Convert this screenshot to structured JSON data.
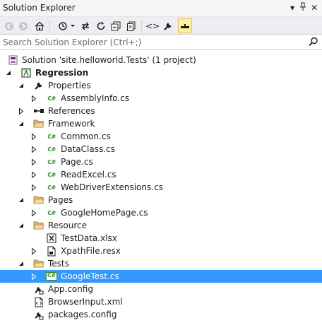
{
  "titlebar": {
    "title": "Solution Explorer",
    "dropdown_glyph": "▾",
    "pin_glyph": "ᛘ",
    "close_glyph": "✕"
  },
  "toolbar": {
    "icons": [
      "back-icon",
      "forward-icon",
      "home-icon",
      "pending-changes-filter-icon",
      "sync-with-active-document-icon",
      "refresh-icon",
      "collapse-all-icon",
      "show-all-files-icon",
      "view-code-icon",
      "properties-icon",
      "preview-selected-items-icon"
    ],
    "view_code_glyph": "<>",
    "active_icon": "preview-selected-items-icon"
  },
  "search": {
    "placeholder": "Search Solution Explorer (Ctrl+;)"
  },
  "tree": {
    "rows": [
      {
        "label": "Solution 'site.helloworld.Tests' (1 project)",
        "icon": "solution-icon",
        "expander": "none",
        "bold": false,
        "selected": false
      },
      {
        "label": "Regression",
        "icon": "test-project-icon",
        "expander": "expanded",
        "bold": true,
        "selected": false
      },
      {
        "label": "Properties",
        "icon": "wrench-icon",
        "expander": "expanded",
        "bold": false,
        "selected": false
      },
      {
        "label": "AssemblyInfo.cs",
        "icon": "csharp-file-icon",
        "expander": "collapsed",
        "bold": false,
        "selected": false
      },
      {
        "label": "References",
        "icon": "references-icon",
        "expander": "collapsed",
        "bold": false,
        "selected": false
      },
      {
        "label": "Framework",
        "icon": "folder-open-icon",
        "expander": "expanded",
        "bold": false,
        "selected": false
      },
      {
        "label": "Common.cs",
        "icon": "csharp-file-icon",
        "expander": "collapsed",
        "bold": false,
        "selected": false
      },
      {
        "label": "DataClass.cs",
        "icon": "csharp-file-icon",
        "expander": "collapsed",
        "bold": false,
        "selected": false
      },
      {
        "label": "Page.cs",
        "icon": "csharp-file-icon",
        "expander": "collapsed",
        "bold": false,
        "selected": false
      },
      {
        "label": "ReadExcel.cs",
        "icon": "csharp-file-icon",
        "expander": "collapsed",
        "bold": false,
        "selected": false
      },
      {
        "label": "WebDriverExtensions.cs",
        "icon": "csharp-file-icon",
        "expander": "collapsed",
        "bold": false,
        "selected": false
      },
      {
        "label": "Pages",
        "icon": "folder-open-icon",
        "expander": "expanded",
        "bold": false,
        "selected": false
      },
      {
        "label": "GoogleHomePage.cs",
        "icon": "csharp-file-icon",
        "expander": "collapsed",
        "bold": false,
        "selected": false
      },
      {
        "label": "Resource",
        "icon": "folder-open-icon",
        "expander": "expanded",
        "bold": false,
        "selected": false
      },
      {
        "label": "TestData.xlsx",
        "icon": "excel-file-icon",
        "expander": "none",
        "bold": false,
        "selected": false
      },
      {
        "label": "XpathFile.resx",
        "icon": "resx-file-icon",
        "expander": "collapsed",
        "bold": false,
        "selected": false
      },
      {
        "label": "Tests",
        "icon": "folder-open-icon",
        "expander": "expanded",
        "bold": false,
        "selected": false
      },
      {
        "label": "GoogleTest.cs",
        "icon": "csharp-file-icon",
        "expander": "collapsed",
        "bold": false,
        "selected": true
      },
      {
        "label": "App.config",
        "icon": "config-file-icon",
        "expander": "none",
        "bold": false,
        "selected": false
      },
      {
        "label": "BrowserInput.xml",
        "icon": "xml-file-icon",
        "expander": "none",
        "bold": false,
        "selected": false
      },
      {
        "label": "packages.config",
        "icon": "config-file-icon",
        "expander": "none",
        "bold": false,
        "selected": false
      }
    ]
  },
  "colors": {
    "selection": "#3399ff",
    "csharp": "#388a34",
    "folder": "#dcb67a",
    "active_tool": "#fff29d"
  }
}
